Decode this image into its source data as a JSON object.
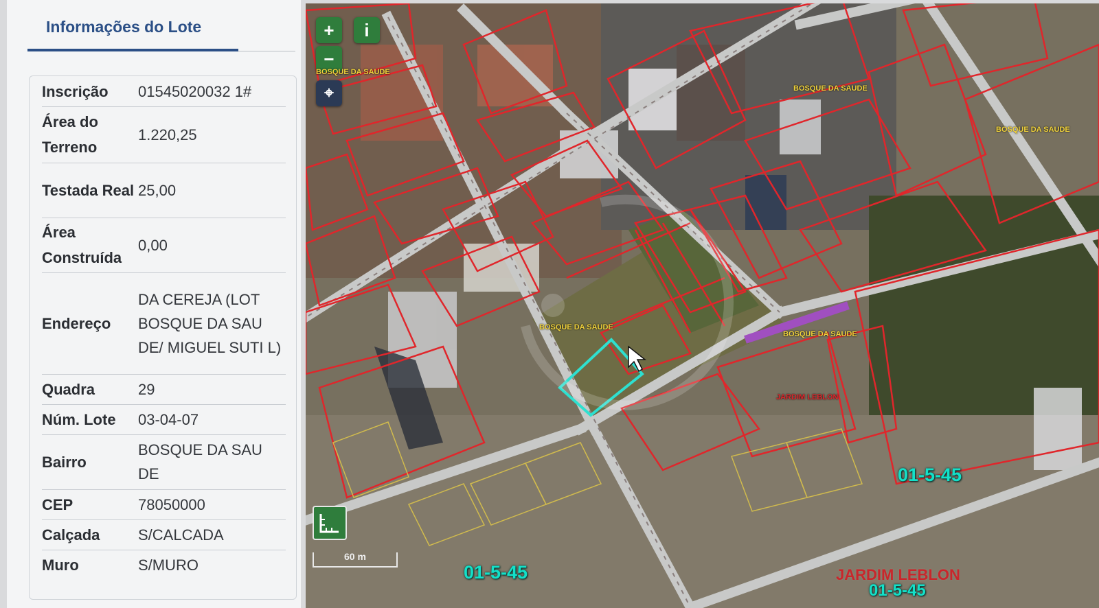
{
  "panel": {
    "title": "Informações do Lote",
    "rows": [
      {
        "label": "Inscrição",
        "value": "01545020032 1#"
      },
      {
        "label": "Área do Terreno",
        "value": "1.220,25"
      },
      {
        "label": "Testada Real",
        "value": "25,00"
      },
      {
        "label": "Área Construída",
        "value": "0,00"
      },
      {
        "label": "Endereço",
        "value": "DA CEREJA (LOT BOSQUE DA SAU DE/ MIGUEL SUTI L)"
      },
      {
        "label": "Quadra",
        "value": "29"
      },
      {
        "label": "Núm. Lote",
        "value": "03-04-07"
      },
      {
        "label": "Bairro",
        "value": "BOSQUE DA SAU DE"
      },
      {
        "label": "CEP",
        "value": "78050000"
      },
      {
        "label": "Calçada",
        "value": "S/CALCADA"
      },
      {
        "label": "Muro",
        "value": "S/MURO"
      }
    ]
  },
  "map": {
    "controls": {
      "zoom_in": "+",
      "zoom_out": "−",
      "info": "i",
      "locate": "⌖"
    },
    "scale_text": "60 m",
    "quadra_labels": [
      "01-5-45",
      "01-5-45",
      "01-5-45"
    ],
    "bairro_labels": [
      "BOSQUE DA SAUDE",
      "BOSQUE DA SAUDE",
      "BOSQUE DA SAUDE",
      "BOSQUE DA SAUDE",
      "BOSQUE DA SAUDE",
      "JARDIM LEBLON"
    ],
    "neighborhood_label": "JARDIM LEBLON",
    "colors": {
      "lot_outline": "#e0262b",
      "selected_lot": "#2ee0d0",
      "control": "#2f7d3c"
    }
  }
}
